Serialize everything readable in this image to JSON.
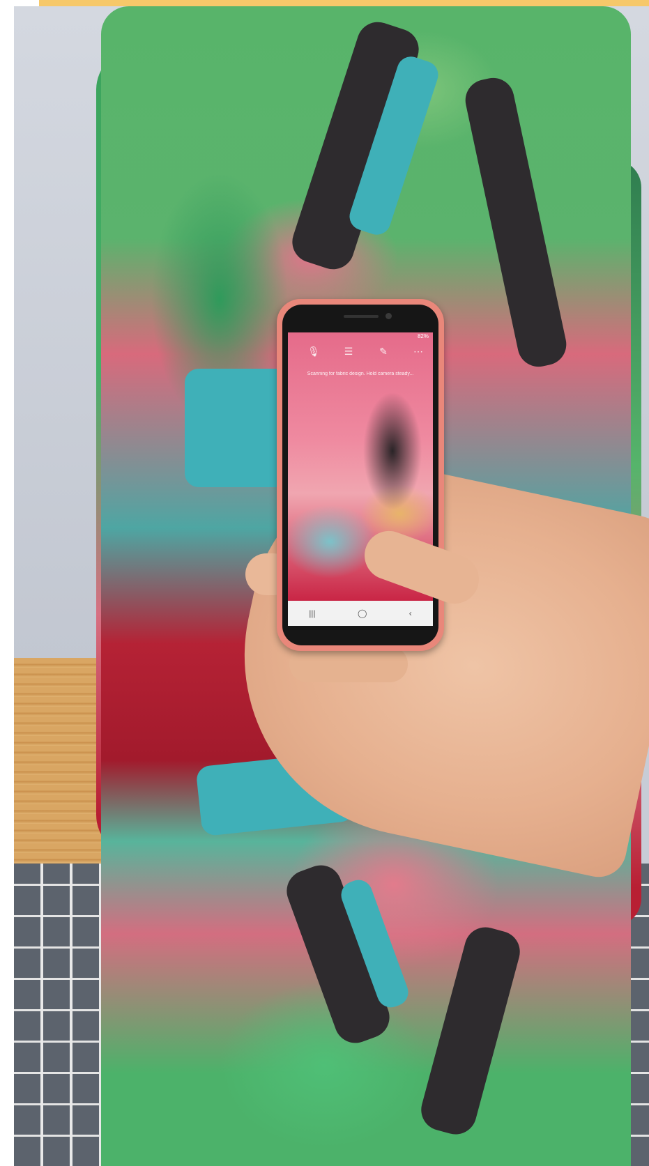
{
  "banner": {
    "color": "#f6c86a"
  },
  "phone": {
    "status": {
      "battery": "82%"
    },
    "toolbar": {
      "icons": [
        "microphone-icon",
        "menu-icon",
        "brush-icon",
        "more-icon"
      ]
    },
    "hint": "Scanning for fabric design. Hold camera steady...",
    "nav": {
      "recent": "|||",
      "home": "◯",
      "back": "‹"
    }
  },
  "colors": {
    "fabric_green": "#58b46a",
    "fabric_pink": "#e0748a",
    "fabric_red": "#a81c2e",
    "fabric_teal": "#3fb0b8",
    "phone_case": "#e9877a"
  }
}
